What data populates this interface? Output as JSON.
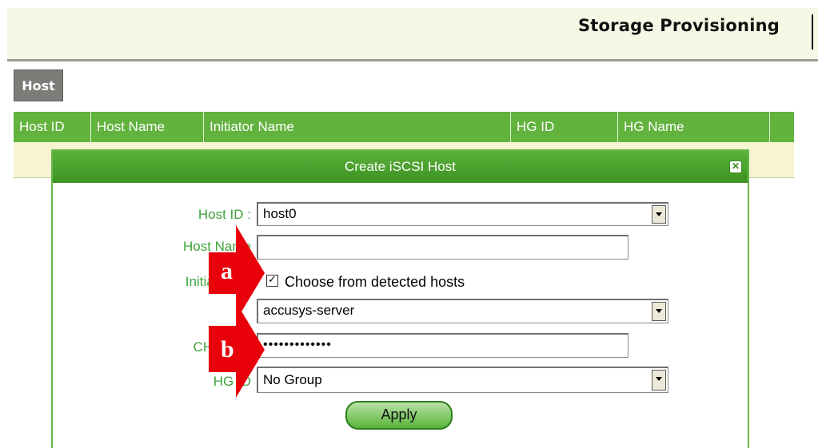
{
  "header": {
    "title": "Storage Provisioning"
  },
  "host_tab": {
    "label": "Host"
  },
  "grid": {
    "columns": [
      "Host ID",
      "Host Name",
      "Initiator Name",
      "HG ID",
      "HG Name"
    ]
  },
  "dialog": {
    "title": "Create iSCSI Host",
    "labels": {
      "host_id": "Host ID :",
      "host_name": "Host Name",
      "initiator_name": "Initiator Na",
      "chap_secret": "CHAP Se",
      "hg_id": "HG ID"
    },
    "host_id_value": "host0",
    "host_name_value": "",
    "detect_checkbox_label": "Choose from detected hosts",
    "detected_host_value": "accusys-server",
    "chap_secret_value": "•••••••••••••",
    "hg_id_value": "No Group",
    "apply_label": "Apply"
  },
  "callouts": {
    "a": "a",
    "b": "b"
  },
  "colors": {
    "callout": "#e8000b",
    "grid_header": "#62b33e",
    "label_green": "#3fa33b"
  },
  "icons": [
    "close-icon",
    "dropdown-arrow-icon",
    "checkbox-checked-icon"
  ]
}
